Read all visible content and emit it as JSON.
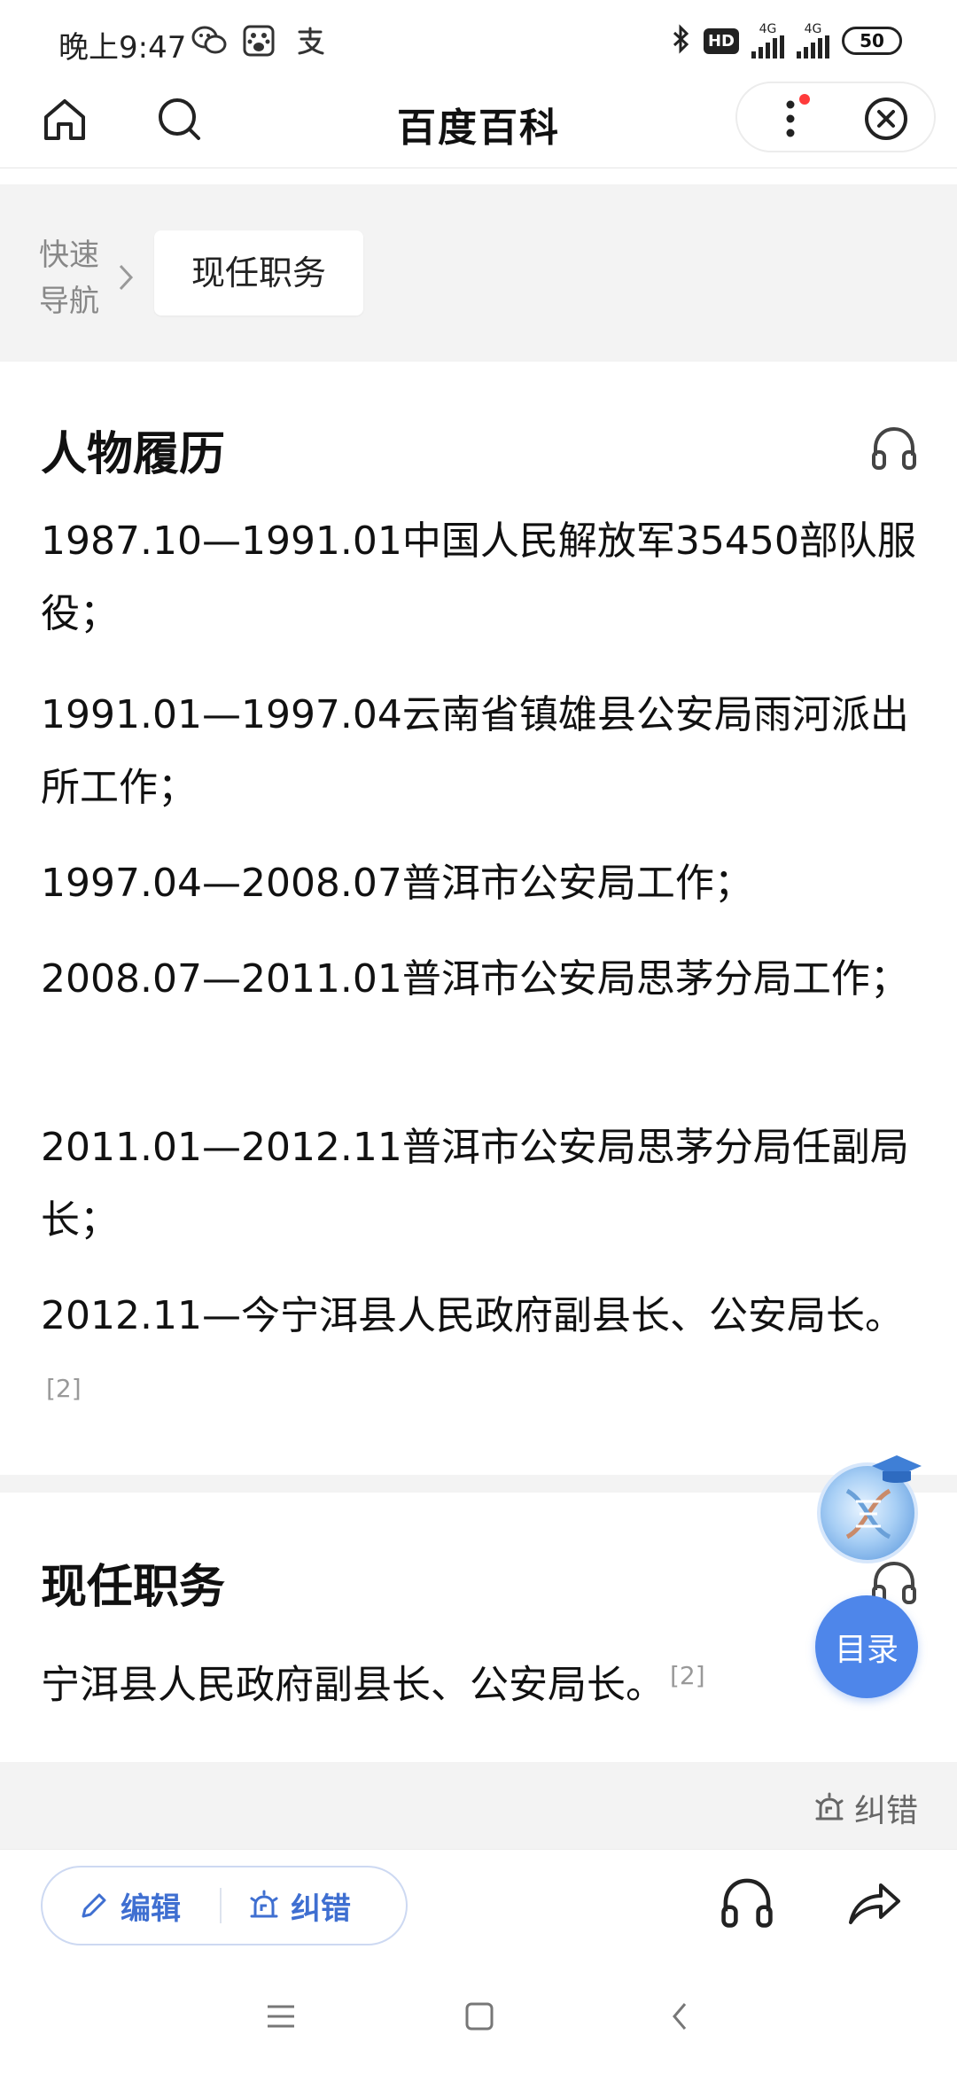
{
  "status_bar": {
    "time": "晚上9:47",
    "app_icons": [
      "wechat-icon",
      "baidu-paw-icon",
      "alipay-icon"
    ],
    "hd": "HD",
    "network1": "4G",
    "network2": "4G",
    "battery": "50"
  },
  "nav": {
    "title": "百度百科"
  },
  "quick_nav": {
    "label": "快速导航",
    "chip": "现任职务"
  },
  "career": {
    "title": "人物履历",
    "entries": [
      {
        "text": "1987.10—1991.01中国人民解放军35450部队服役；"
      },
      {
        "text": "1991.01—1997.04云南省镇雄县公安局雨河派出所工作；"
      },
      {
        "text": "1997.04—2008.07普洱市公安局工作；"
      },
      {
        "text": "2008.07—2011.01普洱市公安局思茅分局工作；"
      },
      {
        "text": "2011.01—2012.11普洱市公安局思茅分局任副局长；"
      },
      {
        "text": "2012.11—今宁洱县人民政府副县长、公安局长。",
        "ref": "[2]"
      }
    ]
  },
  "current_post": {
    "title": "现任职务",
    "text": "宁洱县人民政府副县长、公安局长。",
    "ref": "[2]"
  },
  "footer": {
    "report_label": "纠错"
  },
  "floating": {
    "toc_label": "目录"
  },
  "toolbar": {
    "edit_label": "编辑",
    "report_label": "纠错"
  },
  "colors": {
    "accent": "#4e86ea",
    "toolbar_text": "#3f6fd1",
    "band_bg": "#f3f3f3",
    "notification_dot": "#ff3b3b"
  }
}
